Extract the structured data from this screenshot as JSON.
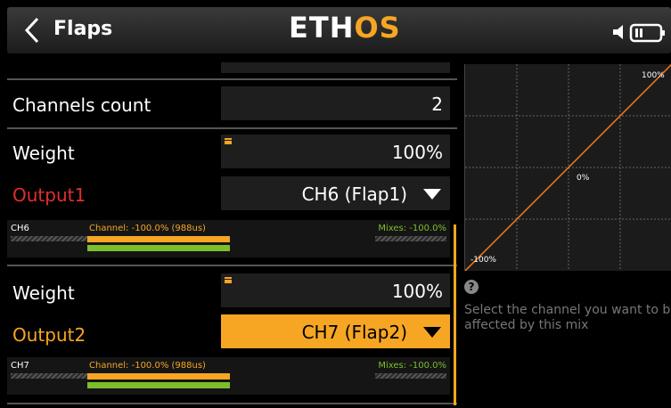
{
  "header": {
    "title": "Flaps",
    "logo_part1": "ETH",
    "logo_part2": "OS"
  },
  "settings": {
    "channels_count_label": "Channels count",
    "channels_count_value": "2",
    "weight1_label": "Weight",
    "weight1_value": "100%",
    "output1_label": "Output1",
    "output1_value": "CH6 (Flap1)",
    "weight2_label": "Weight",
    "weight2_value": "100%",
    "output2_label": "Output2",
    "output2_value": "CH7 (Flap2)"
  },
  "monitors": [
    {
      "channel": "CH6",
      "channel_info": "Channel: -100.0% (988us)",
      "mixes_info": "Mixes: -100.0%"
    },
    {
      "channel": "CH7",
      "channel_info": "Channel: -100.0% (988us)",
      "mixes_info": "Mixes: -100.0%"
    }
  ],
  "graph": {
    "label_max": "100%",
    "label_mid": "0%",
    "label_min": "-100%"
  },
  "help": {
    "icon": "?",
    "line1": "Select the channel you want to b",
    "line2": "affected by this mix"
  },
  "colors": {
    "accent": "#f6a623",
    "output1_label": "#e0302b",
    "output2_label": "#f6a623",
    "mixes_green": "#7cbf2a"
  },
  "icons": [
    "back-arrow-icon",
    "speaker-icon",
    "battery-icon",
    "help-icon",
    "edit-marker-icon",
    "dropdown-arrow-icon"
  ]
}
